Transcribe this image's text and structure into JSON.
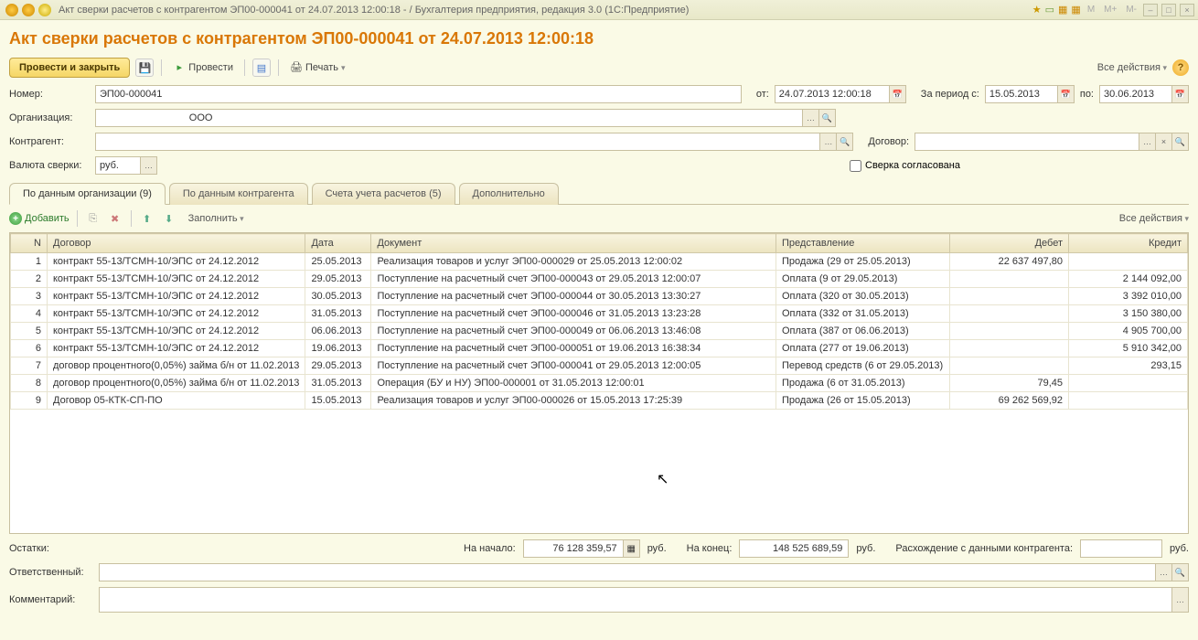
{
  "titlebar": {
    "text": "Акт сверки расчетов с контрагентом ЭП00-000041 от 24.07.2013 12:00:18 -                         / Бухгалтерия предприятия, редакция 3.0   (1С:Предприятие)",
    "m_labels": [
      "M",
      "M+",
      "M-"
    ]
  },
  "page_title": "Акт сверки расчетов с контрагентом ЭП00-000041 от 24.07.2013 12:00:18",
  "toolbar": {
    "post_close": "Провести и закрыть",
    "post": "Провести",
    "print": "Печать",
    "all_actions": "Все действия"
  },
  "fields": {
    "number_label": "Номер:",
    "number_value": "ЭП00-000041",
    "from_label": "от:",
    "from_value": "24.07.2013 12:00:18",
    "period_from_label": "За период с:",
    "period_from_value": "15.05.2013",
    "period_to_label": "по:",
    "period_to_value": "30.06.2013",
    "org_label": "Организация:",
    "org_value": "                                ООО",
    "counterparty_label": "Контрагент:",
    "counterparty_value": "",
    "contract_label": "Договор:",
    "contract_value": "",
    "currency_label": "Валюта сверки:",
    "currency_value": "руб.",
    "agreed_label": "Сверка согласована"
  },
  "tabs": [
    "По данным организации (9)",
    "По данным контрагента",
    "Счета учета расчетов (5)",
    "Дополнительно"
  ],
  "table_toolbar": {
    "add": "Добавить",
    "fill": "Заполнить",
    "all_actions": "Все действия"
  },
  "columns": [
    "N",
    "Договор",
    "Дата",
    "Документ",
    "Представление",
    "Дебет",
    "Кредит"
  ],
  "rows": [
    {
      "n": "1",
      "contract": "контракт 55-13/ТСМН-10/ЭПС от 24.12.2012",
      "date": "25.05.2013",
      "doc": "Реализация товаров и услуг ЭП00-000029 от 25.05.2013 12:00:02",
      "repr": "Продажа (29 от 25.05.2013)",
      "debit": "22 637 497,80",
      "credit": ""
    },
    {
      "n": "2",
      "contract": "контракт 55-13/ТСМН-10/ЭПС от 24.12.2012",
      "date": "29.05.2013",
      "doc": "Поступление на расчетный счет ЭП00-000043 от 29.05.2013 12:00:07",
      "repr": "Оплата (9 от 29.05.2013)",
      "debit": "",
      "credit": "2 144 092,00"
    },
    {
      "n": "3",
      "contract": "контракт 55-13/ТСМН-10/ЭПС от 24.12.2012",
      "date": "30.05.2013",
      "doc": "Поступление на расчетный счет ЭП00-000044 от 30.05.2013 13:30:27",
      "repr": "Оплата (320 от 30.05.2013)",
      "debit": "",
      "credit": "3 392 010,00"
    },
    {
      "n": "4",
      "contract": "контракт 55-13/ТСМН-10/ЭПС от 24.12.2012",
      "date": "31.05.2013",
      "doc": "Поступление на расчетный счет ЭП00-000046 от 31.05.2013 13:23:28",
      "repr": "Оплата (332 от 31.05.2013)",
      "debit": "",
      "credit": "3 150 380,00"
    },
    {
      "n": "5",
      "contract": "контракт 55-13/ТСМН-10/ЭПС от 24.12.2012",
      "date": "06.06.2013",
      "doc": "Поступление на расчетный счет ЭП00-000049 от 06.06.2013 13:46:08",
      "repr": "Оплата (387 от 06.06.2013)",
      "debit": "",
      "credit": "4 905 700,00"
    },
    {
      "n": "6",
      "contract": "контракт 55-13/ТСМН-10/ЭПС от 24.12.2012",
      "date": "19.06.2013",
      "doc": "Поступление на расчетный счет ЭП00-000051 от 19.06.2013 16:38:34",
      "repr": "Оплата (277 от 19.06.2013)",
      "debit": "",
      "credit": "5 910 342,00"
    },
    {
      "n": "7",
      "contract": "договор процентного(0,05%) займа б/н от 11.02.2013",
      "date": "29.05.2013",
      "doc": "Поступление на расчетный счет ЭП00-000041 от 29.05.2013 12:00:05",
      "repr": "Перевод средств (6 от 29.05.2013)",
      "debit": "",
      "credit": "293,15"
    },
    {
      "n": "8",
      "contract": "договор процентного(0,05%) займа б/н от 11.02.2013",
      "date": "31.05.2013",
      "doc": "Операция (БУ и НУ) ЭП00-000001 от 31.05.2013 12:00:01",
      "repr": "Продажа (6 от 31.05.2013)",
      "debit": "79,45",
      "credit": ""
    },
    {
      "n": "9",
      "contract": "Договор 05-КТК-СП-ПО",
      "date": "15.05.2013",
      "doc": "Реализация товаров и услуг ЭП00-000026 от 15.05.2013 17:25:39",
      "repr": "Продажа (26 от 15.05.2013)",
      "debit": "69 262 569,92",
      "credit": ""
    }
  ],
  "footer": {
    "balances_label": "Остатки:",
    "start_label": "На начало:",
    "start_value": "76 128 359,57",
    "rub": "руб.",
    "end_label": "На конец:",
    "end_value": "148 525 689,59",
    "diff_label": "Расхождение с данными контрагента:",
    "diff_value": "",
    "responsible_label": "Ответственный:",
    "responsible_value": "",
    "comment_label": "Комментарий:",
    "comment_value": ""
  }
}
